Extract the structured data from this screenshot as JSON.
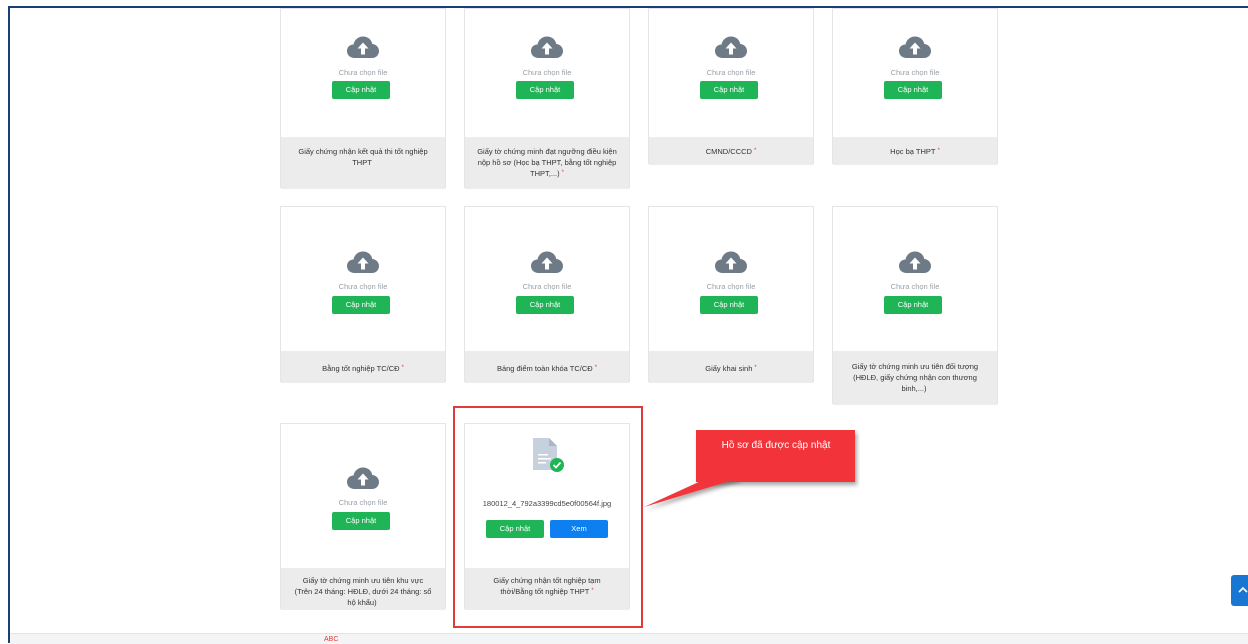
{
  "documents": [
    {
      "no_file": "Chưa chọn file",
      "update": "Cập nhật",
      "label": "Giấy chứng nhận kết quả thi tốt nghiệp THPT",
      "required": ""
    },
    {
      "no_file": "Chưa chọn file",
      "update": "Cập nhật",
      "label": "Giấy tờ chứng minh đạt ngưỡng điều kiện nộp hồ sơ (Học bạ THPT, bằng tốt nghiệp THPT,...)",
      "required": "*"
    },
    {
      "no_file": "Chưa chọn file",
      "update": "Cập nhật",
      "label": "CMND/CCCD",
      "required": "*"
    },
    {
      "no_file": "Chưa chọn file",
      "update": "Cập nhật",
      "label": "Học bạ THPT",
      "required": "*"
    },
    {
      "no_file": "Chưa chọn file",
      "update": "Cập nhật",
      "label": "Bằng tốt nghiệp TC/CĐ",
      "required": "*"
    },
    {
      "no_file": "Chưa chọn file",
      "update": "Cập nhật",
      "label": "Bảng điểm toàn khóa TC/CĐ",
      "required": "*"
    },
    {
      "no_file": "Chưa chọn file",
      "update": "Cập nhật",
      "label": "Giấy khai sinh",
      "required": "*"
    },
    {
      "no_file": "Chưa chọn file",
      "update": "Cập nhật",
      "label": "Giấy tờ chứng minh ưu tiên đối tượng (HĐLĐ, giấy chứng nhận con thương binh,...)",
      "required": ""
    },
    {
      "no_file": "Chưa chọn file",
      "update": "Cập nhật",
      "label": "Giấy tờ chứng minh ưu tiên khu vực (Trên 24 tháng: HĐLĐ, dưới 24 tháng: sổ hộ khẩu)",
      "required": ""
    }
  ],
  "uploaded": {
    "file_name": "180012_4_792a3399cd5e0f00564f.jpg",
    "update": "Cập nhật",
    "view": "Xem",
    "label": "Giấy chứng nhận tốt nghiệp tạm thời/Bằng tốt nghiệp THPT",
    "required": "*"
  },
  "callout": {
    "text": "Hồ sơ đã được cập nhật"
  },
  "footer_peek": "ABC",
  "colors": {
    "green": "#1fb456",
    "blue": "#0d7ff0",
    "highlight": "#e03a3a",
    "callout": "#f2343a",
    "frame": "#1a3d7c"
  },
  "icons": {
    "upload": "cloud-upload-icon",
    "file": "file-check-icon",
    "scroll": "chevron-up-icon"
  }
}
